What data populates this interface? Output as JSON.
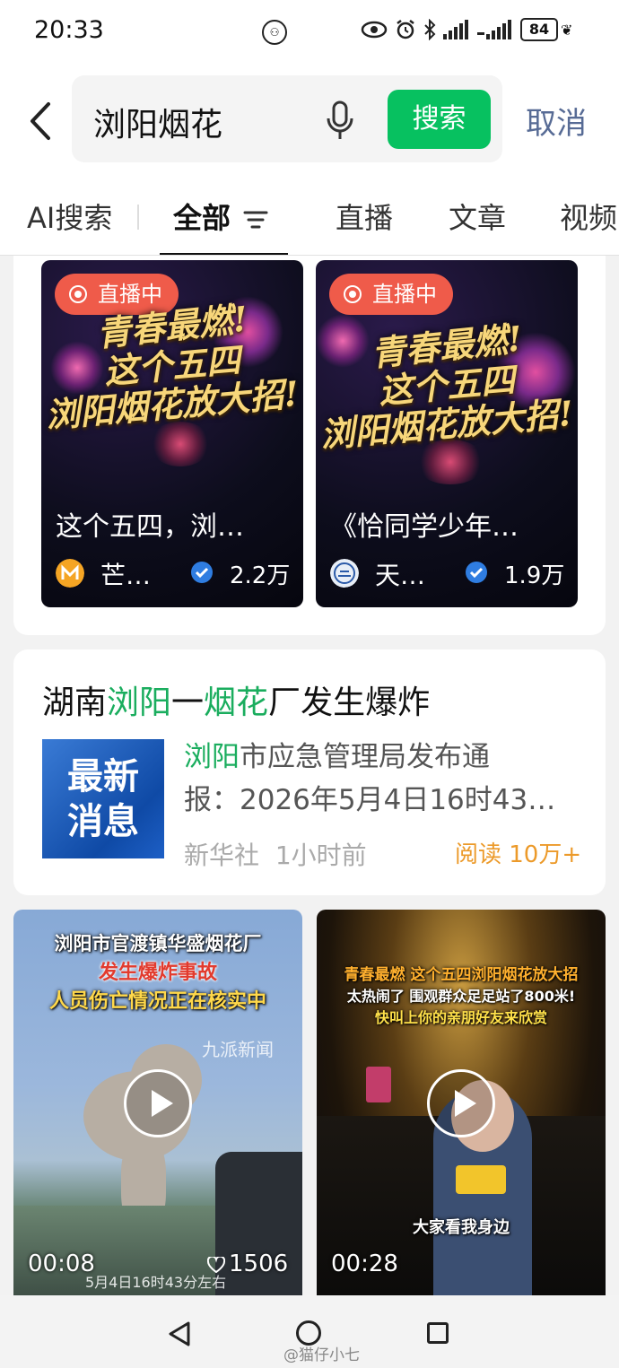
{
  "status": {
    "time": "20:33",
    "battery": "84"
  },
  "search": {
    "query": "浏阳烟花",
    "button": "搜索",
    "cancel": "取消"
  },
  "tabs": [
    "AI搜索",
    "全部",
    "直播",
    "文章",
    "视频"
  ],
  "live_cards": [
    {
      "badge": "直播中",
      "poster_lines": [
        "青春最燃!",
        "这个五四",
        "浏阳烟花放大招!"
      ],
      "title": "这个五四，浏…",
      "author": "芒…",
      "count": "2.2万"
    },
    {
      "badge": "直播中",
      "poster_lines": [
        "青春最燃!",
        "这个五四",
        "浏阳烟花放大招!"
      ],
      "title": "《恰同学少年…",
      "author": "天…",
      "count": "1.9万"
    }
  ],
  "news": {
    "title_parts": [
      "湖南",
      "浏阳",
      "一",
      "烟花",
      "厂发生爆炸"
    ],
    "thumb_lines": [
      "最新",
      "消息"
    ],
    "snippet_hl": "浏阳",
    "snippet_rest": "市应急管理局发布通",
    "snippet_line2": "报：2026年5月4日16时43…",
    "source": "新华社",
    "time": "1小时前",
    "reads": "阅读 10万+"
  },
  "videos": [
    {
      "caption_lines": [
        "浏阳市官渡镇华盛烟花厂",
        "发生爆炸事故",
        "人员伤亡情况正在核实中"
      ],
      "watermark": "九派新闻",
      "bottom_caption": "5月4日16时43分左右",
      "duration": "00:08",
      "likes": "1506"
    },
    {
      "caption_lines": [
        "青春最燃 这个五四浏阳烟花放大招",
        "太热闹了 围观群众足足站了800米!",
        "快叫上你的亲朋好友来欣赏"
      ],
      "bottom_caption": "大家看我身边",
      "duration": "00:28"
    }
  ],
  "footer": {
    "watermark": "@猫仔小七"
  },
  "colors": {
    "accent_green": "#07c160",
    "highlight_green": "#1aad5e",
    "live_red": "#ef5b4a",
    "link_blue": "#576b95",
    "reads_orange": "#ec9a2a"
  }
}
